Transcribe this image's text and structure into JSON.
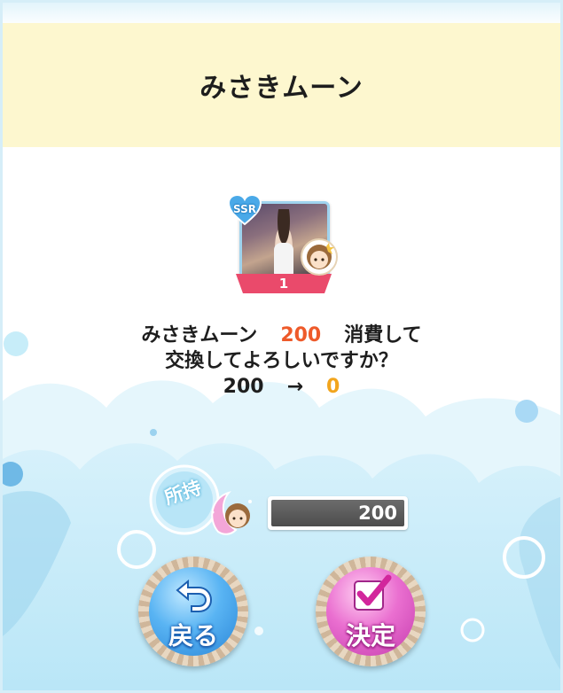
{
  "dialog": {
    "title": "みさきムーン"
  },
  "item": {
    "rarity": "SSR",
    "count": "1"
  },
  "message": {
    "item_name": "みさきムーン",
    "cost": "200",
    "consume_text": "消費して",
    "question": "交換してよろしいですか？",
    "before": "200",
    "arrow": "→",
    "after": "0"
  },
  "owned": {
    "label": "所持",
    "value": "200"
  },
  "buttons": {
    "back_label": "戻る",
    "confirm_label": "決定"
  },
  "colors": {
    "title_band": "#fdf7cf",
    "cost_highlight": "#ee5a2a",
    "after_highlight": "#f2a51d",
    "back_button": "#2b86d8",
    "confirm_button": "#c53dae",
    "bubble": "#c7edf9"
  },
  "icons": {
    "back": "return-arrow-icon",
    "confirm": "checkbox-icon",
    "owned_item": "moon-chibi-icon"
  }
}
